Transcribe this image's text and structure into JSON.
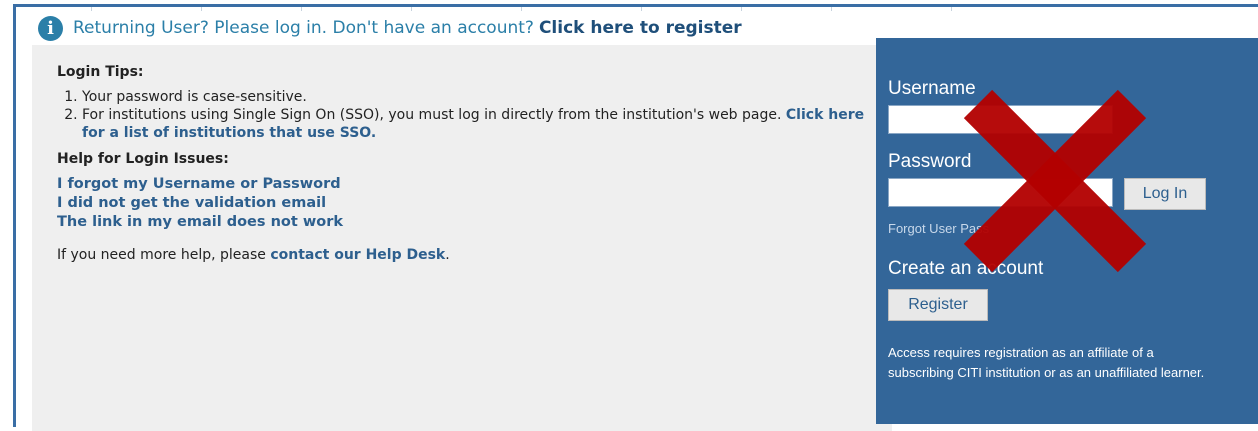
{
  "header": {
    "text": "Returning User? Please log in. Don't have an account?",
    "register_link": "Click here to register"
  },
  "login_tips": {
    "title": "Login Tips:",
    "item1": "Your password is case-sensitive.",
    "item2": "For institutions using Single Sign On (SSO), you must log in directly from the institution's web page.",
    "item2_link": "Click here for a list of institutions that use SSO."
  },
  "help": {
    "title": "Help for Login Issues:",
    "links": [
      "I forgot my Username or Password",
      "I did not get the validation email",
      "The link in my email does not work"
    ],
    "more_text": "If you need more help, please",
    "help_desk_link": "contact our Help Desk",
    "more_suffix": "."
  },
  "login_form": {
    "username_label": "Username",
    "username_value": "",
    "password_label": "Password",
    "password_value": "",
    "login_button": "Log In",
    "forgot_text": "Forgot User      Pass",
    "create_label": "Create an account",
    "register_button": "Register",
    "access_note": "Access requires registration as an affiliate of a subscribing CITI institution or as an unaffiliated learner."
  },
  "colors": {
    "panel_blue": "#336699",
    "link_blue": "#2d5f8e",
    "header_blue": "#2b7fa8",
    "x_red": "#b30000"
  }
}
